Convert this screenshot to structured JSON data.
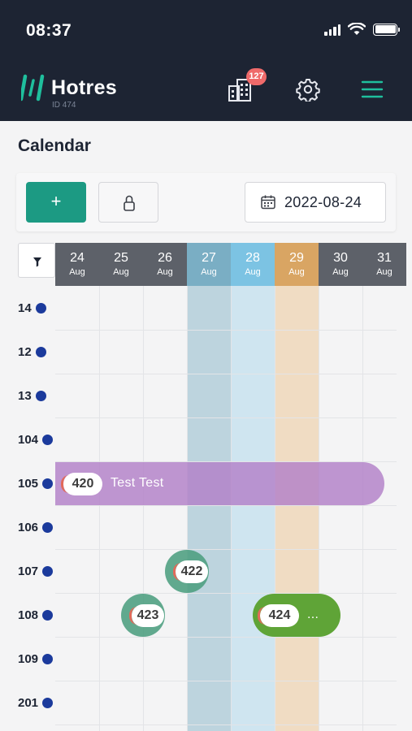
{
  "status": {
    "time": "08:37"
  },
  "app": {
    "brand": "Hotres",
    "property_id": "ID 474",
    "notification_count": "127",
    "logo_color": "#1fbf9d",
    "accent": "#1c9a83"
  },
  "page": {
    "title": "Calendar"
  },
  "toolbar": {
    "add_label": "+",
    "date_value": "2022-08-24"
  },
  "calendar": {
    "days": [
      {
        "day": "24",
        "month": "Aug",
        "state": "past"
      },
      {
        "day": "25",
        "month": "Aug",
        "state": "past"
      },
      {
        "day": "26",
        "month": "Aug",
        "state": "past"
      },
      {
        "day": "27",
        "month": "Aug",
        "state": "weekend-sat"
      },
      {
        "day": "28",
        "month": "Aug",
        "state": "weekend-sun"
      },
      {
        "day": "29",
        "month": "Aug",
        "state": "today"
      },
      {
        "day": "30",
        "month": "Aug",
        "state": "normal"
      },
      {
        "day": "31",
        "month": "Aug",
        "state": "normal"
      }
    ],
    "rooms": [
      "14",
      "12",
      "13",
      "104",
      "105",
      "106",
      "107",
      "108",
      "109",
      "201"
    ],
    "bookings": [
      {
        "id": "420",
        "guest": "Test Test",
        "room": "105",
        "status": "purple"
      },
      {
        "id": "422",
        "guest": "",
        "room": "107",
        "status": "green"
      },
      {
        "id": "423",
        "guest": "",
        "room": "108",
        "status": "green"
      },
      {
        "id": "424",
        "guest": "...",
        "room": "108",
        "status": "green-active"
      }
    ],
    "colors": {
      "past": "#5d6169",
      "normal": "#5d6169",
      "weekend_sat": "#7aaec4",
      "weekend_sun": "#7cc3e3",
      "today": "#d9a563"
    }
  }
}
